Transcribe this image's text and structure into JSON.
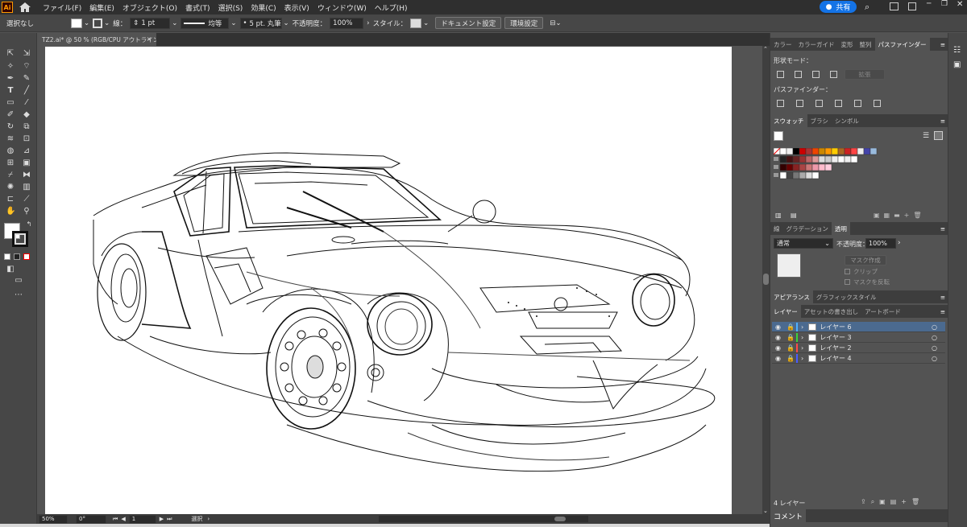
{
  "app": {
    "logo": "Ai"
  },
  "menu": [
    "ファイル(F)",
    "編集(E)",
    "オブジェクト(O)",
    "書式(T)",
    "選択(S)",
    "効果(C)",
    "表示(V)",
    "ウィンドウ(W)",
    "ヘルプ(H)"
  ],
  "share_label": "共有",
  "control": {
    "selection": "選択なし",
    "stroke_label": "線：",
    "stroke_value": "1 pt",
    "stroke_style": "均等",
    "brush": "5 pt. 丸筆",
    "opacity_label": "不透明度：",
    "opacity_value": "100%",
    "style_label": "スタイル：",
    "doc_setup": "ドキュメント設定",
    "prefs": "環境設定"
  },
  "document_tab": "TZ2.ai* @ 50 % (RGB/CPU アウトライン)",
  "status": {
    "zoom": "50%",
    "angle": "0°",
    "page": "1",
    "tool": "選択"
  },
  "panels": {
    "top_tabs": [
      "カラー",
      "カラーガイド",
      "変形",
      "整列",
      "パスファインダー"
    ],
    "shape_modes": "形状モード：",
    "expand": "拡張",
    "pathfinder": "パスファインダー：",
    "swatch_tabs": [
      "スウォッチ",
      "ブラシ",
      "シンボル"
    ],
    "trans_tabs": [
      "線",
      "グラデーション",
      "透明"
    ],
    "blend_mode": "通常",
    "opacity_label": "不透明度：",
    "opacity_value": "100%",
    "make_mask": "マスク作成",
    "clip": "クリップ",
    "invert_mask": "マスクを反転",
    "appearance_tabs": [
      "アピアランス",
      "グラフィックスタイル"
    ],
    "layer_tabs": [
      "レイヤー",
      "アセットの書き出し",
      "アートボード"
    ],
    "layers": [
      {
        "name": "レイヤー 6",
        "color": "#4fb0ff",
        "selected": true
      },
      {
        "name": "レイヤー 3",
        "color": "#3ad33a",
        "selected": false
      },
      {
        "name": "レイヤー 2",
        "color": "#ff4b4b",
        "selected": false
      },
      {
        "name": "レイヤー 4",
        "color": "#4b5bff",
        "selected": false
      }
    ],
    "layer_count": "4 レイヤー",
    "comment": "コメント"
  }
}
